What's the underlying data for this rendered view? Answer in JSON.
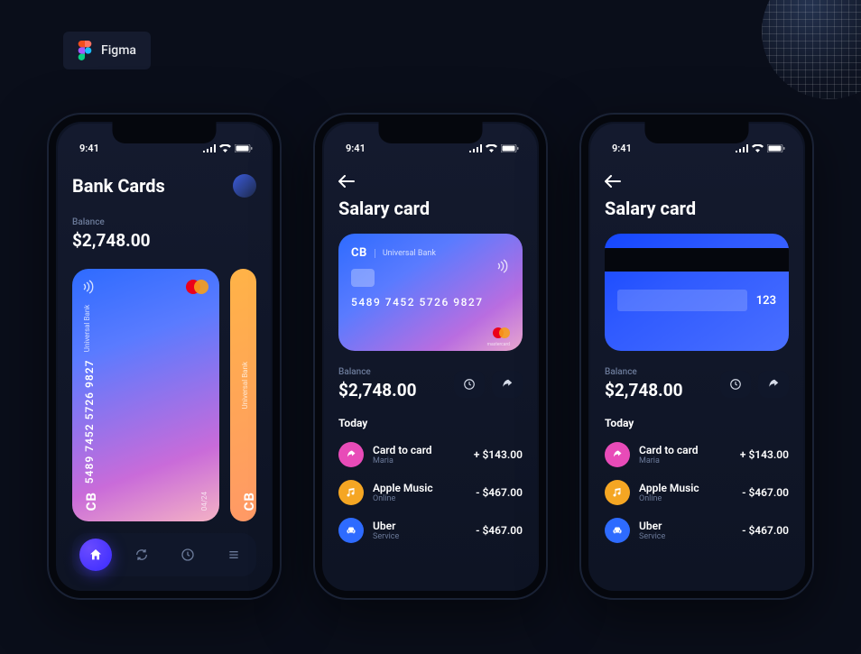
{
  "figma_badge": {
    "label": "Figma"
  },
  "status": {
    "time": "9:41"
  },
  "screen1": {
    "title": "Bank Cards",
    "balance_label": "Balance",
    "balance_amount": "$2,748.00",
    "card": {
      "cb": "CB",
      "bank": "Universal Bank",
      "number": "5489 7452 5726 9827",
      "expiry": "04/24"
    },
    "card2": {
      "cb": "CB",
      "bank": "Universal Bank"
    }
  },
  "screen2": {
    "title": "Salary card",
    "card": {
      "cb": "CB",
      "bank": "Universal Bank",
      "number": "5489 7452 5726 9827",
      "brand": "mastercard"
    },
    "balance_label": "Balance",
    "balance_amount": "$2,748.00",
    "section": "Today",
    "tx": [
      {
        "title": "Card to card",
        "sub": "Maria",
        "amount": "+ $143.00",
        "color": "pink"
      },
      {
        "title": "Apple Music",
        "sub": "Online",
        "amount": "- $467.00",
        "color": "orange"
      },
      {
        "title": "Uber",
        "sub": "Service",
        "amount": "- $467.00",
        "color": "blue"
      }
    ]
  },
  "screen3": {
    "title": "Salary card",
    "card_back": {
      "cvv": "123"
    },
    "balance_label": "Balance",
    "balance_amount": "$2,748.00",
    "section": "Today",
    "tx": [
      {
        "title": "Card to card",
        "sub": "Maria",
        "amount": "+ $143.00",
        "color": "pink"
      },
      {
        "title": "Apple Music",
        "sub": "Online",
        "amount": "- $467.00",
        "color": "orange"
      },
      {
        "title": "Uber",
        "sub": "Service",
        "amount": "- $467.00",
        "color": "blue"
      }
    ]
  }
}
